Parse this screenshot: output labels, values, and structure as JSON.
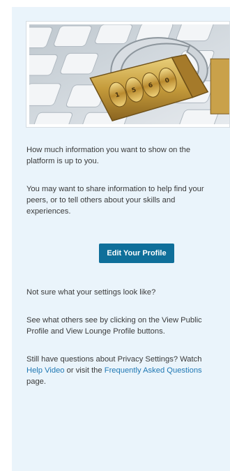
{
  "hero": {
    "image": "padlock-on-keyboard-image"
  },
  "intro": {
    "line1a": "How much information you want to show on the",
    "line1b": "platform is up to you.",
    "line2a": "You may want to share information to help find your",
    "line2b": "peers, or to tell others about your skills and",
    "line2c": "experiences."
  },
  "cta": {
    "label": "Edit Your Profile"
  },
  "settings": {
    "question": "Not sure what your settings look like?",
    "see_a": "See what others see by clicking on the View Public",
    "see_b": "Profile and View Lounge Profile buttons."
  },
  "help": {
    "lead": "Still have questions about Privacy Settings? Watch",
    "link_video": "Help Video",
    "mid": " or visit the ",
    "link_faq": "Frequently Asked Questions",
    "tail": "page."
  },
  "colors": {
    "panel_bg": "#eaf4fb",
    "button_bg": "#0f6f9a",
    "link": "#1f78b4",
    "text": "#3a3a3a"
  }
}
